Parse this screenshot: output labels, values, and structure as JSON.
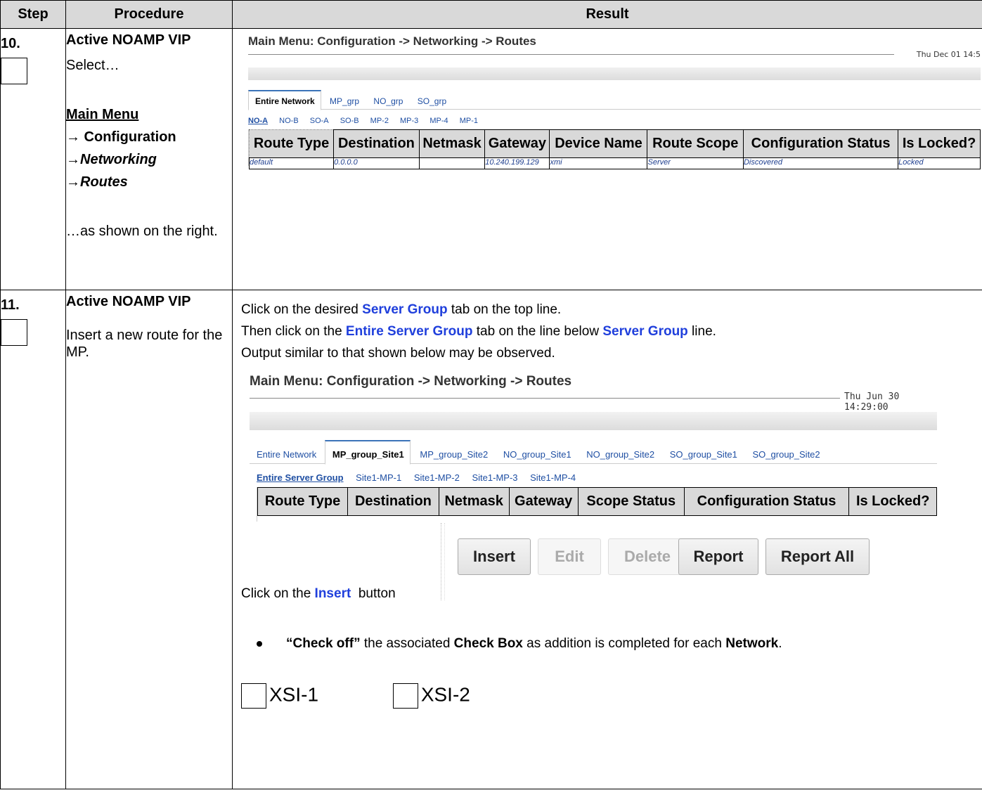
{
  "headers": {
    "step": "Step",
    "procedure": "Procedure",
    "result": "Result"
  },
  "step10": {
    "number": "10.",
    "proc_title": "Active NOAMP VIP",
    "proc_select": "Select…",
    "menu_main": "Main Menu",
    "menu_config": "→ Configuration",
    "menu_networking": "→Networking",
    "menu_routes": "→Routes",
    "proc_shown": "…as shown on the right.",
    "shot": {
      "title": "Main Menu: Configuration -> Networking -> Routes",
      "date": "Thu Dec 01 14:5",
      "tabs": [
        "Entire Network",
        "MP_grp",
        "NO_grp",
        "SO_grp"
      ],
      "subtabs": [
        "NO-A",
        "NO-B",
        "SO-A",
        "SO-B",
        "MP-2",
        "MP-3",
        "MP-4",
        "MP-1"
      ],
      "columns": [
        "Route Type",
        "Destination",
        "Netmask",
        "Gateway",
        "Device Name",
        "Route Scope",
        "Configuration Status",
        "Is Locked?"
      ],
      "row": [
        "default",
        "0.0.0.0",
        "",
        "10.240.199.129",
        "xmi",
        "Server",
        "Discovered",
        "Locked"
      ]
    }
  },
  "step11": {
    "number": "11.",
    "proc_title": "Active NOAMP VIP",
    "proc_desc": "Insert a new route for the MP.",
    "line1_pre": "Click on the desired ",
    "line1_em": "Server Group",
    "line1_post": " tab on the top line.",
    "line2_pre": "Then click on the ",
    "line2_em": "Entire Server Group",
    "line2_mid": " tab on the line below ",
    "line2_em2": "Server Group",
    "line2_post": " line.",
    "line3": "Output similar to that shown below may be observed.",
    "shot": {
      "title": "Main Menu: Configuration -> Networking -> Routes",
      "date": "Thu Jun 30 14:29:00",
      "tabs": [
        "Entire Network",
        "MP_group_Site1",
        "MP_group_Site2",
        "NO_group_Site1",
        "NO_group_Site2",
        "SO_group_Site1",
        "SO_group_Site2"
      ],
      "subtabs": [
        "Entire Server Group",
        "Site1-MP-1",
        "Site1-MP-2",
        "Site1-MP-3",
        "Site1-MP-4"
      ],
      "columns": [
        "Route Type",
        "Destination",
        "Netmask",
        "Gateway",
        "Scope Status",
        "Configuration Status",
        "Is Locked?"
      ]
    },
    "buttons": {
      "insert": "Insert",
      "edit": "Edit",
      "delete": "Delete",
      "report": "Report",
      "report_all": "Report All"
    },
    "click_pre": "Click on the ",
    "click_em": "Insert",
    "click_post": "  button",
    "bullet_b1": "“Check off”",
    "bullet_t1": " the associated ",
    "bullet_b2": "Check Box",
    "bullet_t2": " as addition is completed for each ",
    "bullet_b3": "Network",
    "bullet_t3": ".",
    "check1": "XSI-1",
    "check2": "XSI-2"
  }
}
